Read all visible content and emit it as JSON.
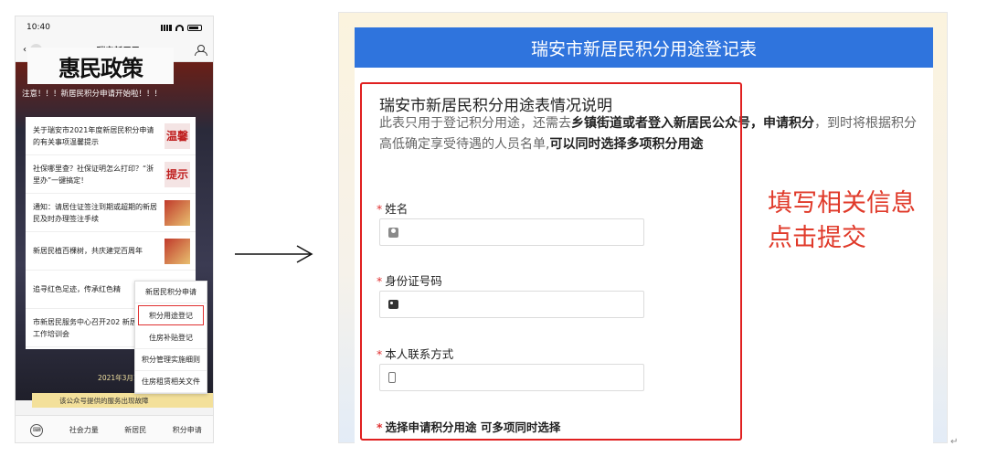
{
  "phone": {
    "time": "10:40",
    "back_count": "1",
    "title": "瑞安新居民",
    "banner_text": "惠民政策",
    "notice": "注意！！！新居民积分申请开始啦！！！",
    "articles": [
      {
        "text": "关于瑞安市2021年度新居民积分申请的有关事项温馨提示",
        "thumb": "温馨"
      },
      {
        "text": "社保哪里查？社保证明怎么打印？“浙里办”一键搞定！",
        "thumb": "提示"
      },
      {
        "text": "通知：请居住证签注到期或超期的新居民及时办理签注手续",
        "thumb": ""
      },
      {
        "text": "新居民植百棵树，共庆建党百周年",
        "thumb": ""
      },
      {
        "text": "追寻红色足迹，传承红色精",
        "thumb": ""
      },
      {
        "text": "市新居民服务中心召开202 新居民积分工作培训会",
        "thumb": ""
      }
    ],
    "menu": [
      "新居民积分申请",
      "积分用途登记",
      "住房补贴登记",
      "积分管理实施细则",
      "住房租赁相关文件"
    ],
    "date_caption": "2021年3月18日",
    "footer_note": "该公众号提供的服务出现故障",
    "tabs": [
      "社会力量",
      "新居民",
      "积分申请"
    ]
  },
  "form": {
    "header": "瑞安市新居民积分用途登记表",
    "intro_title": "瑞安市新居民积分用途表情况说明",
    "intro_desc_1": "此表只用于登记积分用途，还需去",
    "intro_desc_2": "乡镇街道或者登入新居民公众号，申请积分",
    "intro_desc_3": "，到时将根据积分高低确定享受待遇的人员名单,",
    "intro_desc_4": "可以同时选择多项积分用途",
    "fields": [
      {
        "label": "姓名",
        "icon": "user-icon"
      },
      {
        "label": "身份证号码",
        "icon": "id-card-icon"
      },
      {
        "label": "本人联系方式",
        "icon": "phone-icon"
      }
    ],
    "choice_label": "选择申请积分用途 可多项同时选择",
    "required_mark": "*"
  },
  "callout": {
    "line1": "填写相关信息",
    "line2": "点击提交"
  },
  "colors": {
    "header_blue": "#2f74dd",
    "highlight_red": "#e02020",
    "callout_red": "#e03a2a"
  }
}
